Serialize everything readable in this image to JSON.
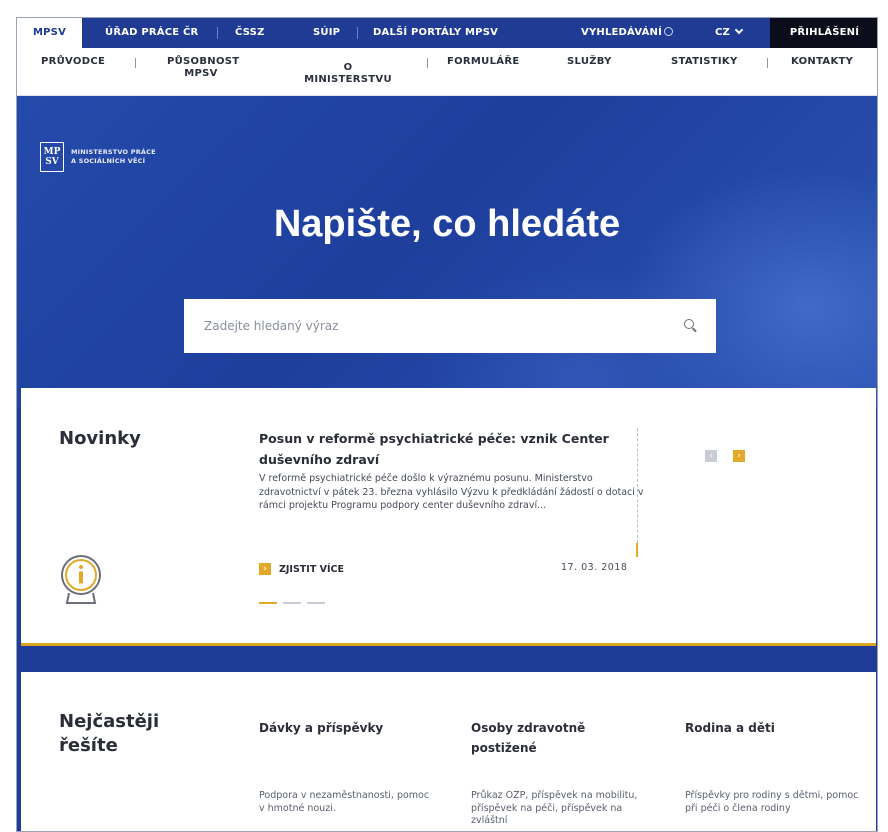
{
  "topbar": {
    "items": [
      "MPSV",
      "ÚŘAD PRÁCE ČR",
      "ČSSZ",
      "SÚIP",
      "DALŠÍ PORTÁLY MPSV"
    ],
    "search_label": "VYHLEDÁVÁNÍ",
    "lang": "CZ",
    "login_label": "PŘIHLÁŠENÍ"
  },
  "nav": {
    "items": [
      "PRŮVODCE",
      "PŮSOBNOST MPSV",
      "O MINISTERSTVU",
      "FORMULÁŘE",
      "SLUŽBY",
      "STATISTIKY",
      "KONTAKTY"
    ]
  },
  "logo": {
    "mark_top": "MP",
    "mark_bottom": "SV",
    "line1": "MINISTERSTVO PRÁCE",
    "line2": "A SOCIÁLNÍCH VĚCÍ"
  },
  "hero": {
    "title": "Napište, co hledáte",
    "search_placeholder": "Zadejte hledaný výraz"
  },
  "news": {
    "heading": "Novinky",
    "title": "Posun v reformě psychiatrické péče: vznik Center duševního zdraví",
    "text": "V reformě psychiatrické péče došlo k výraznému posunu. Ministerstvo zdravotnictví v pátek 23. března vyhlásilo Výzvu k předkládání žádostí o dotaci v rámci projektu Programu podpory center duševního zdraví...",
    "more_label": "ZJISTIT VÍCE",
    "date": "17. 03. 2018",
    "prev_icon": "chevron-left-icon",
    "next_icon": "chevron-right-icon",
    "slides": 3,
    "active_slide": 1
  },
  "common": {
    "heading": "Nejčastěji řešíte",
    "columns": [
      {
        "title": "Dávky a příspěvky",
        "desc": "Podpora v nezaměstnanosti, pomoc v hmotné nouzi."
      },
      {
        "title": "Osoby zdravotně postižené",
        "desc": "Průkaz OZP, příspěvek na mobilitu, příspěvek na péči, příspěvek na zvláštní"
      },
      {
        "title": "Rodina a děti",
        "desc": "Příspěvky pro rodiny s dětmi, pomoc při péči o člena rodiny"
      }
    ]
  },
  "colors": {
    "brand_blue": "#203b94",
    "accent_yellow": "#e3a828",
    "login_bg": "#0b0e1a"
  }
}
